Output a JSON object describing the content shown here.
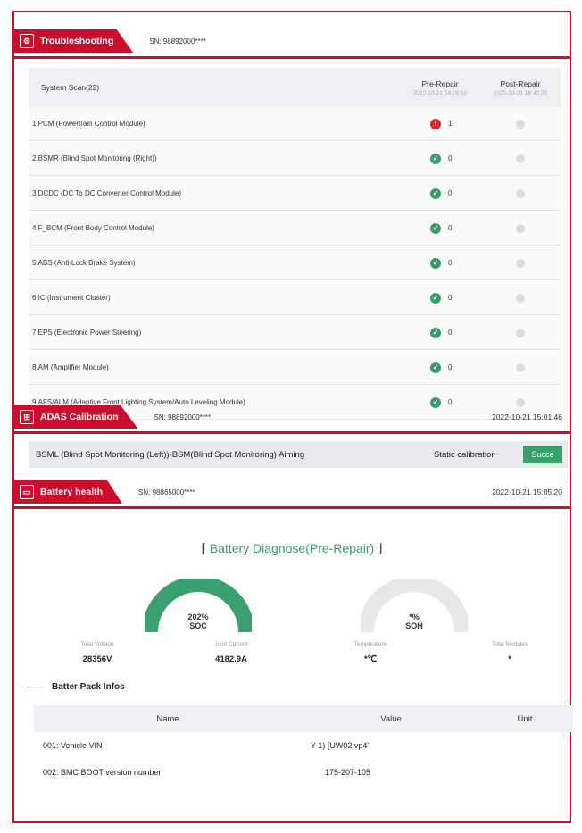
{
  "troubleshooting": {
    "title": "Troubleshooting",
    "sn": "SN: 98892000****",
    "table": {
      "col_name": "System Scan(22)",
      "col_pre": "Pre-Repair",
      "col_pre_date": "2022-10-21 14:09:10",
      "col_post": "Post-Repair",
      "col_post_date": "2022-10-21 16:42:20",
      "rows": [
        {
          "name": "1.PCM (Powertrain Control Module)",
          "status": "error",
          "count": "1"
        },
        {
          "name": "2.BSMR (Blind Spot Monitoring (Right))",
          "status": "ok",
          "count": "0"
        },
        {
          "name": "3.DCDC (DC To DC Converter Control Module)",
          "status": "ok",
          "count": "0"
        },
        {
          "name": "4.F_BCM (Front Body Control Module)",
          "status": "ok",
          "count": "0"
        },
        {
          "name": "5.ABS (Anti-Lock Brake System)",
          "status": "ok",
          "count": "0"
        },
        {
          "name": "6.IC (Instrument Cluster)",
          "status": "ok",
          "count": "0"
        },
        {
          "name": "7.EPS (Electronic Power Steering)",
          "status": "ok",
          "count": "0"
        },
        {
          "name": "8.AM (Amplifier Module)",
          "status": "ok",
          "count": "0"
        },
        {
          "name": "9.AFS/ALM (Adaptive Front Lighting System/Auto Leveling Module)",
          "status": "ok",
          "count": "0"
        }
      ]
    }
  },
  "adas": {
    "title": "ADAS Calibration",
    "sn": "SN: 98892000****",
    "timestamp": "2022-10-21 15:01:46",
    "item": "BSML (Blind Spot Monitoring (Left))-BSM(Blind Spot Monitoring) Aiming",
    "mode": "Static calibration",
    "result": "Succe"
  },
  "battery": {
    "title": "Battery health",
    "sn": "SN: 98865000****",
    "timestamp": "2022-10-21 15:05:20",
    "diagnose_title": "Battery Diagnose(Pre-Repair)",
    "soc": {
      "value": "202%",
      "label": "SOC",
      "fraction": 1.0
    },
    "soh": {
      "value": "*%",
      "label": "SOH",
      "fraction": 0.0
    },
    "stats": [
      {
        "label": "Total Voltage",
        "value": "28356V"
      },
      {
        "label": "Joint Current",
        "value": "4182.9A"
      },
      {
        "label": "Temperature",
        "value": "*℃"
      },
      {
        "label": "Total Modules",
        "value": "*"
      }
    ],
    "pack_title": "Batter Pack Infos",
    "pack_table": {
      "col_name": "Name",
      "col_value": "Value",
      "col_unit": "Unit",
      "rows": [
        {
          "name": "001: Vehicle VIN",
          "value": "Y  1)  [UW02 vp4'"
        },
        {
          "name": "002: BMC BOOT version number",
          "value": "175-207-105"
        }
      ]
    }
  },
  "colors": {
    "brand_red": "#c8102e",
    "ok_green": "#3a9a6a",
    "error_red": "#d42b2b"
  }
}
